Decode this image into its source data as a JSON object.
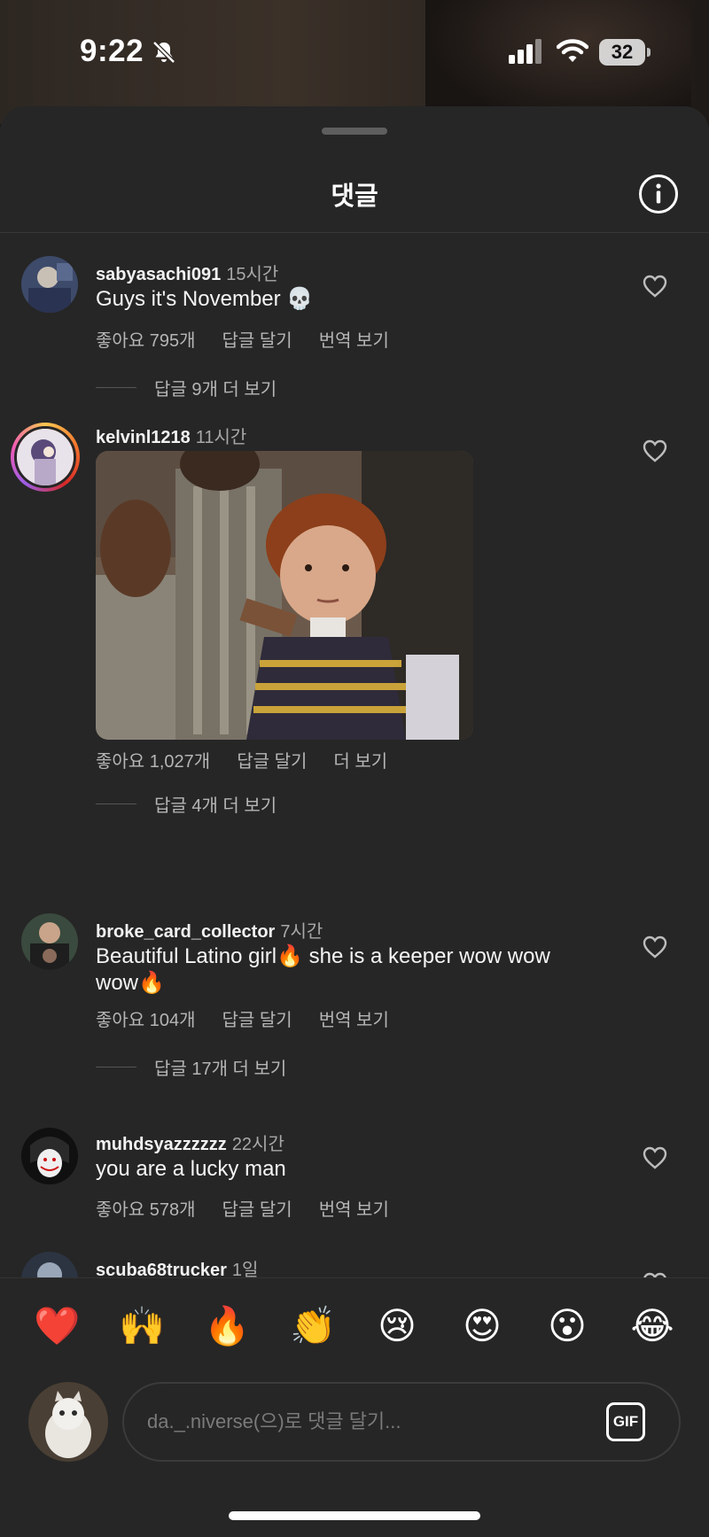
{
  "status_bar": {
    "time": "9:22",
    "battery": "32"
  },
  "sheet": {
    "title": "댓글"
  },
  "comments": [
    {
      "user": "sabyasachi091",
      "ago": "15시간",
      "text": "Guys it's November 💀",
      "likes": "좋아요 795개",
      "reply": "답글 달기",
      "extra": "번역 보기",
      "more_replies": "답글 9개 더 보기"
    },
    {
      "user": "kelvinl1218",
      "ago": "11시간",
      "text": "",
      "likes": "좋아요 1,027개",
      "reply": "답글 달기",
      "extra": "더 보기",
      "more_replies": "답글 4개 더 보기"
    },
    {
      "user": "broke_card_collector",
      "ago": "7시간",
      "text": "Beautiful Latino girl🔥 she is a keeper wow wow wow🔥",
      "likes": "좋아요 104개",
      "reply": "답글 달기",
      "extra": "번역 보기",
      "more_replies": "답글 17개 더 보기"
    },
    {
      "user": "muhdsyazzzzzz",
      "ago": "22시간",
      "text": "you are a lucky man",
      "likes": "좋아요 578개",
      "reply": "답글 달기",
      "extra": "번역 보기"
    },
    {
      "user": "scuba68trucker",
      "ago": "1일"
    }
  ],
  "emoji_bar": [
    "❤️",
    "🙌",
    "🔥",
    "👏",
    "😢",
    "😍",
    "😮",
    "😂"
  ],
  "composer": {
    "placeholder": "da._.niverse(으)로 댓글 달기...",
    "gif_label": "GIF"
  },
  "icons": {
    "bell": "bell-slash-icon",
    "signal": "cellular-signal-icon",
    "wifi": "wifi-icon",
    "info": "info-icon",
    "heart": "heart-outline-icon"
  }
}
